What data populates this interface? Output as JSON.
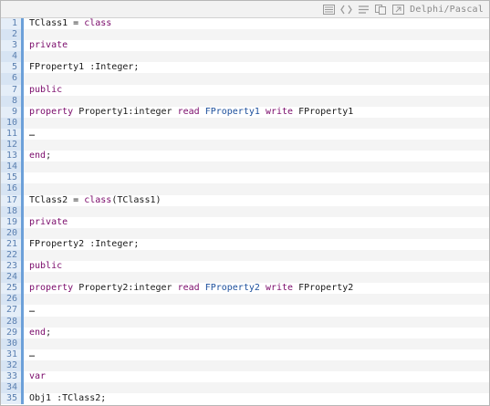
{
  "toolbar": {
    "language_label": "Delphi/Pascal",
    "icons": [
      "view-source-icon",
      "code-icon",
      "wrap-icon",
      "copy-icon",
      "popup-icon"
    ]
  },
  "colors": {
    "keyword": "#7a0a6a",
    "field": "#1c4f9c",
    "gutter_border": "#6ca0d9",
    "line_number": "#5a7fb0"
  },
  "lines": [
    {
      "num": "1",
      "tokens": [
        {
          "t": "TClass1 = ",
          "c": "plain"
        },
        {
          "t": "class",
          "c": "kw"
        }
      ]
    },
    {
      "num": "2",
      "tokens": []
    },
    {
      "num": "3",
      "tokens": [
        {
          "t": "private",
          "c": "kw"
        }
      ]
    },
    {
      "num": "4",
      "tokens": []
    },
    {
      "num": "5",
      "tokens": [
        {
          "t": "FProperty1 :Integer;",
          "c": "plain"
        }
      ]
    },
    {
      "num": "6",
      "tokens": []
    },
    {
      "num": "7",
      "tokens": [
        {
          "t": "public",
          "c": "kw"
        }
      ]
    },
    {
      "num": "8",
      "tokens": []
    },
    {
      "num": "9",
      "tokens": [
        {
          "t": "property",
          "c": "kw"
        },
        {
          "t": " Property1:integer ",
          "c": "plain"
        },
        {
          "t": "read",
          "c": "kw"
        },
        {
          "t": " ",
          "c": "plain"
        },
        {
          "t": "FProperty1",
          "c": "field"
        },
        {
          "t": " ",
          "c": "plain"
        },
        {
          "t": "write",
          "c": "kw"
        },
        {
          "t": " FProperty1",
          "c": "plain"
        }
      ]
    },
    {
      "num": "10",
      "tokens": []
    },
    {
      "num": "11",
      "tokens": [
        {
          "t": "…",
          "c": "plain"
        }
      ]
    },
    {
      "num": "12",
      "tokens": []
    },
    {
      "num": "13",
      "tokens": [
        {
          "t": "end",
          "c": "kw"
        },
        {
          "t": ";",
          "c": "plain"
        }
      ]
    },
    {
      "num": "14",
      "tokens": []
    },
    {
      "num": "15",
      "tokens": []
    },
    {
      "num": "16",
      "tokens": []
    },
    {
      "num": "17",
      "tokens": [
        {
          "t": "TClass2 = ",
          "c": "plain"
        },
        {
          "t": "class",
          "c": "kw"
        },
        {
          "t": "(TClass1)",
          "c": "plain"
        }
      ]
    },
    {
      "num": "18",
      "tokens": []
    },
    {
      "num": "19",
      "tokens": [
        {
          "t": "private",
          "c": "kw"
        }
      ]
    },
    {
      "num": "20",
      "tokens": []
    },
    {
      "num": "21",
      "tokens": [
        {
          "t": "FProperty2 :Integer;",
          "c": "plain"
        }
      ]
    },
    {
      "num": "22",
      "tokens": []
    },
    {
      "num": "23",
      "tokens": [
        {
          "t": "public",
          "c": "kw"
        }
      ]
    },
    {
      "num": "24",
      "tokens": []
    },
    {
      "num": "25",
      "tokens": [
        {
          "t": "property",
          "c": "kw"
        },
        {
          "t": " Property2:integer ",
          "c": "plain"
        },
        {
          "t": "read",
          "c": "kw"
        },
        {
          "t": " ",
          "c": "plain"
        },
        {
          "t": "FProperty2",
          "c": "field"
        },
        {
          "t": " ",
          "c": "plain"
        },
        {
          "t": "write",
          "c": "kw"
        },
        {
          "t": " FProperty2",
          "c": "plain"
        }
      ]
    },
    {
      "num": "26",
      "tokens": []
    },
    {
      "num": "27",
      "tokens": [
        {
          "t": "…",
          "c": "plain"
        }
      ]
    },
    {
      "num": "28",
      "tokens": []
    },
    {
      "num": "29",
      "tokens": [
        {
          "t": "end",
          "c": "kw"
        },
        {
          "t": ";",
          "c": "plain"
        }
      ]
    },
    {
      "num": "30",
      "tokens": []
    },
    {
      "num": "31",
      "tokens": [
        {
          "t": "…",
          "c": "plain"
        }
      ]
    },
    {
      "num": "32",
      "tokens": []
    },
    {
      "num": "33",
      "tokens": [
        {
          "t": "var",
          "c": "kw"
        }
      ]
    },
    {
      "num": "34",
      "tokens": []
    },
    {
      "num": "35",
      "tokens": [
        {
          "t": "Obj1 :TClass2;",
          "c": "plain"
        }
      ]
    }
  ]
}
